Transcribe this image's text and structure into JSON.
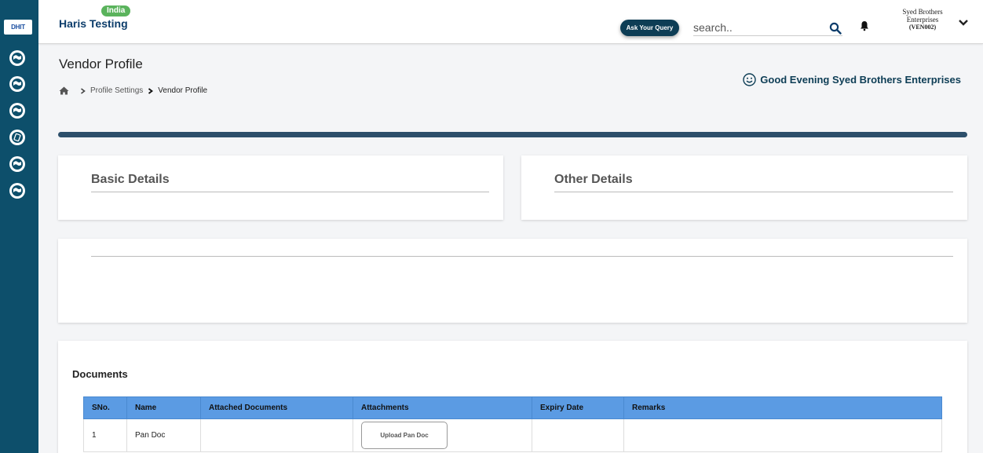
{
  "sidebar": {
    "logo_text": "DHIT",
    "icons": [
      "globe-icon",
      "globe-icon",
      "globe-icon",
      "compass-icon",
      "globe-icon",
      "globe-icon"
    ]
  },
  "header": {
    "region_badge": "India",
    "org_name": "Haris Testing",
    "ask_button": "Ask Your Query",
    "search_placeholder": "search..",
    "user_line1": "Syed Brothers",
    "user_line2": "Enterprises",
    "user_code": "(VEN002)"
  },
  "page": {
    "title": "Vendor Profile",
    "breadcrumb": [
      "Profile Settings",
      "Vendor Profile"
    ],
    "greeting": "Good Evening Syed Brothers Enterprises"
  },
  "cards": {
    "basic_title": "Basic Details",
    "other_title": "Other Details"
  },
  "documents": {
    "title": "Documents",
    "columns": [
      "SNo.",
      "Name",
      "Attached Documents",
      "Attachments",
      "Expiry Date",
      "Remarks"
    ],
    "rows": [
      {
        "sno": "1",
        "name": "Pan Doc",
        "attached": "",
        "upload_label": "Upload Pan Doc",
        "expiry": "",
        "remarks": ""
      }
    ]
  },
  "colors": {
    "sidebar": "#0d4f6b",
    "accent": "#2d4f6b",
    "table_header": "#5b9be3",
    "badge": "#5ab35c"
  }
}
